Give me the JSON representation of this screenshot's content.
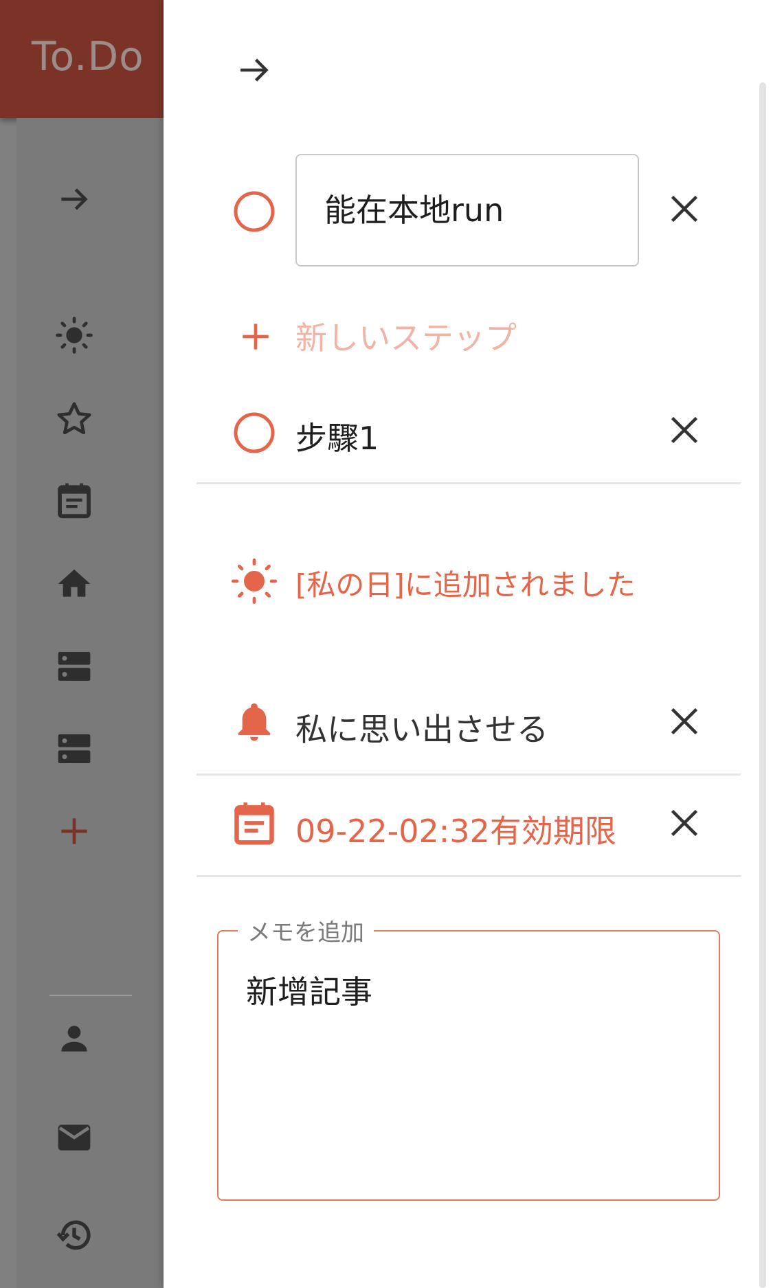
{
  "app": {
    "title": "To.Do"
  },
  "sidebar": {
    "items": [
      {
        "name": "collapse",
        "icon": "arrow-right-icon"
      },
      {
        "name": "my-day",
        "icon": "sun-icon"
      },
      {
        "name": "important",
        "icon": "star-icon"
      },
      {
        "name": "planned",
        "icon": "calendar-icon"
      },
      {
        "name": "tasks",
        "icon": "home-icon"
      },
      {
        "name": "list-1",
        "icon": "list-storage-icon"
      },
      {
        "name": "list-2",
        "icon": "list-storage-icon"
      },
      {
        "name": "new-list",
        "icon": "plus-icon"
      },
      {
        "name": "account",
        "icon": "person-icon"
      },
      {
        "name": "mail",
        "icon": "mail-icon"
      },
      {
        "name": "history",
        "icon": "history-icon"
      }
    ]
  },
  "detail": {
    "task_title": "能在本地run",
    "new_step_placeholder": "新しいステップ",
    "steps": [
      {
        "label": "步驟1"
      }
    ],
    "my_day_label": "[私の日]に追加されました",
    "remind_label": "私に思い出させる",
    "due_label": "09-22-02:32有効期限",
    "note_legend": "メモを追加",
    "note_text": "新增記事"
  },
  "colors": {
    "accent": "#e3654a",
    "appbar": "#7a3326",
    "sidebar": "#7a7a7a",
    "icon_dark": "#2e2e2e",
    "placeholder": "#f1b3a6"
  }
}
